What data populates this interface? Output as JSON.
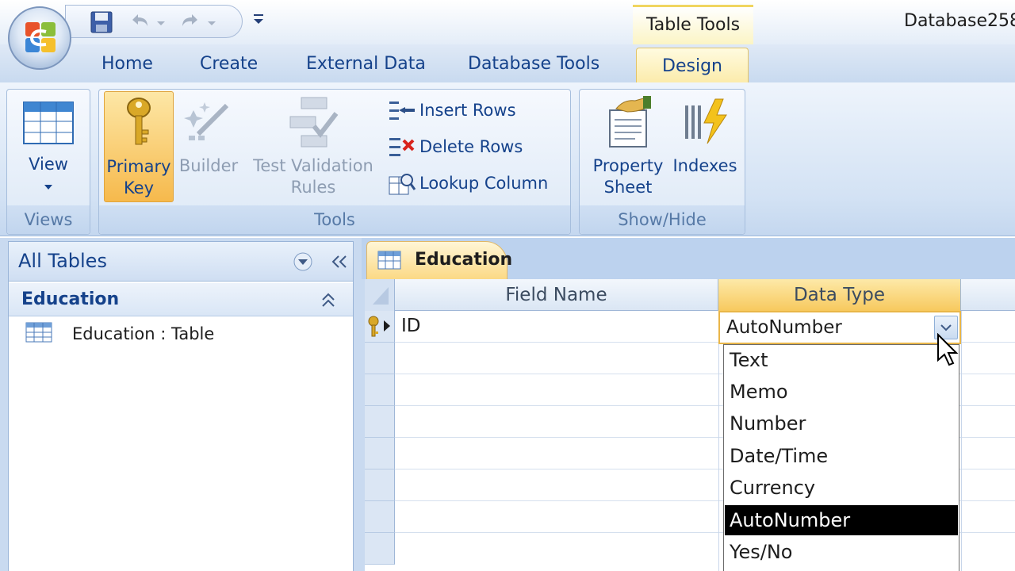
{
  "titlebar": {
    "app_title": "Database258",
    "contextual_group": "Table Tools"
  },
  "tabs": [
    {
      "label": "Home"
    },
    {
      "label": "Create"
    },
    {
      "label": "External Data"
    },
    {
      "label": "Database Tools"
    },
    {
      "label": "Design",
      "active": true
    }
  ],
  "ribbon": {
    "views": {
      "label": "Views",
      "view_button": "View"
    },
    "tools": {
      "label": "Tools",
      "primary_key": [
        "Primary",
        "Key"
      ],
      "builder": "Builder",
      "test_validation": [
        "Test Validation",
        "Rules"
      ],
      "insert_rows": "Insert Rows",
      "delete_rows": "Delete Rows",
      "lookup_column": "Lookup Column"
    },
    "show_hide": {
      "label": "Show/Hide",
      "property_sheet": [
        "Property",
        "Sheet"
      ],
      "indexes": "Indexes"
    }
  },
  "nav": {
    "title": "All Tables",
    "group": "Education",
    "items": [
      {
        "label": "Education : Table"
      }
    ]
  },
  "document": {
    "tab": "Education",
    "columns": [
      "Field Name",
      "Data Type"
    ],
    "rows": [
      {
        "field": "ID",
        "type": "AutoNumber",
        "primary_key": true
      }
    ]
  },
  "dropdown": {
    "options": [
      "Text",
      "Memo",
      "Number",
      "Date/Time",
      "Currency",
      "AutoNumber",
      "Yes/No"
    ],
    "selected": "AutoNumber"
  },
  "colors": {
    "ribbon_text": "#15428b",
    "contextual_accent": "#f0d560",
    "selection": "#000000"
  }
}
